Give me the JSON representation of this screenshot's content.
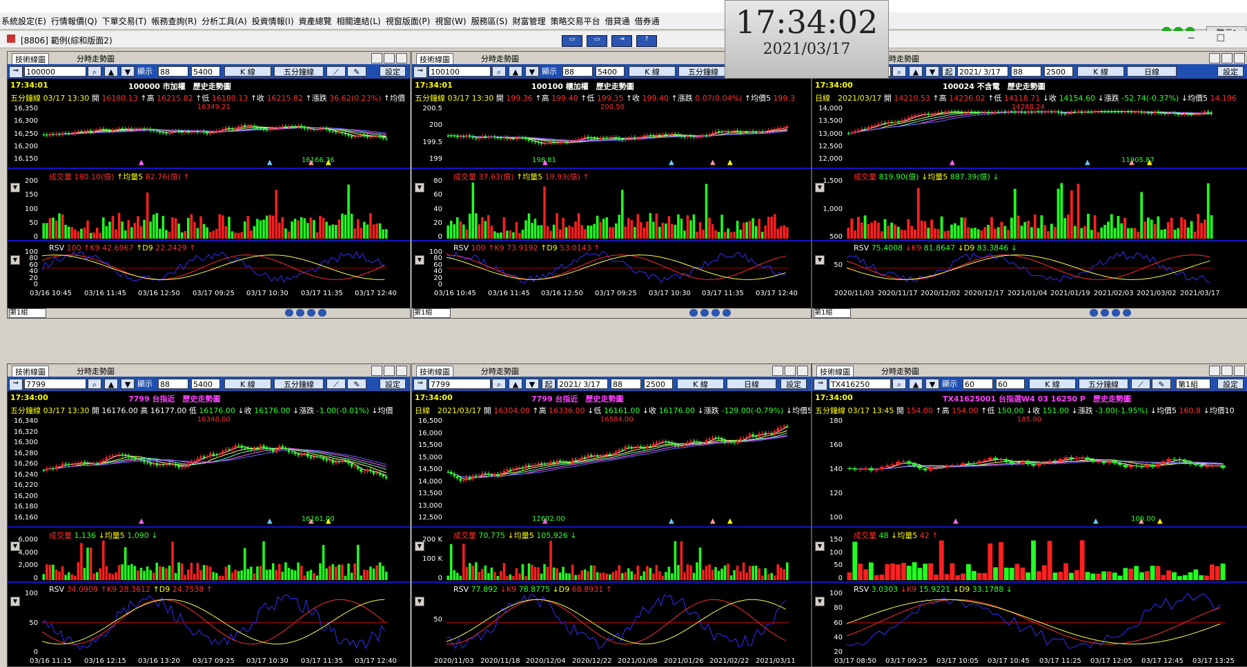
{
  "menu": [
    "系統設定(E)",
    "行情報價(Q)",
    "下單交易(T)",
    "帳務查詢(R)",
    "分析工具(A)",
    "投資情報(I)",
    "資產總覽",
    "相關連結(L)",
    "視窗版面(P)",
    "視窗(W)",
    "服務區(S)",
    "財富管理",
    "策略交易平台",
    "借貸通",
    "借券通"
  ],
  "clock": {
    "time": "17:34:02",
    "date": "2021/03/17"
  },
  "alarm_label": "警示!",
  "doc_title": "[8806] 範例(綜和版面2)",
  "tabs": {
    "tech": "技術線圖",
    "intraday": "分時走勢圖"
  },
  "settings_label": "設定",
  "display_label": "顯示",
  "kline_label": "K 線",
  "five_min_label": "五分鐘線",
  "daily_label": "日線",
  "group_label": "第1組",
  "panels": [
    {
      "code": "100000",
      "n": "88",
      "count": "5400",
      "period": "五分鐘線",
      "time": "17:34:01",
      "title": "100000 市加權　歷史走勢圖",
      "quote": [
        [
          "五分鐘線 03/17 13:30",
          "y"
        ],
        [
          " 開 ",
          "w"
        ],
        [
          "16180.13",
          "r"
        ],
        [
          " ↑高 ",
          "w"
        ],
        [
          "16215.82",
          "r"
        ],
        [
          " ↑低 ",
          "w"
        ],
        [
          "16180.13",
          "r"
        ],
        [
          " ↑收 ",
          "w"
        ],
        [
          "16215.82",
          "r"
        ],
        [
          " ↑漲跌 ",
          "w"
        ],
        [
          "36.62(0.23%)",
          "r"
        ],
        [
          " ↑均價",
          "w"
        ]
      ],
      "vol": [
        [
          "成交量 ",
          "r"
        ],
        [
          "180.10(億)",
          "r"
        ],
        [
          " ↑均量5 ",
          "y"
        ],
        [
          "82.76(億)",
          "r"
        ],
        [
          " ↑",
          "r"
        ]
      ],
      "kd": [
        [
          "RSV ",
          "w"
        ],
        [
          "100",
          "r"
        ],
        [
          " ↑K9 ",
          "r"
        ],
        [
          "42.6967",
          "r"
        ],
        [
          " ↑D9 ",
          "y"
        ],
        [
          "22.2429",
          "r"
        ],
        [
          " ↑",
          "r"
        ]
      ],
      "yprice": [
        "16,350",
        "16,300",
        "16,250",
        "16,200",
        "16,150"
      ],
      "yvol": [
        "200",
        "150",
        "100",
        "50",
        "0"
      ],
      "ykd": [
        "100",
        "80",
        "60",
        "40",
        "20",
        "0"
      ],
      "x": [
        "03/16 10:45",
        "03/16 11:45",
        "03/16 12:50",
        "03/17 09:25",
        "03/17 10:30",
        "03/17 11:35",
        "03/17 12:40"
      ],
      "hi": "16349.21",
      "lo": "16166.36"
    },
    {
      "code": "100100",
      "n": "88",
      "count": "5400",
      "period": "五分鐘線",
      "time": "17:34:01",
      "title": "100100 櫃加權　歷史走勢圖",
      "quote": [
        [
          "五分鐘線 03/17 13:30",
          "y"
        ],
        [
          " 開 ",
          "w"
        ],
        [
          "199.36",
          "r"
        ],
        [
          " ↑高 ",
          "w"
        ],
        [
          "199.40",
          "r"
        ],
        [
          " ↑低 ",
          "w"
        ],
        [
          "199.35",
          "r"
        ],
        [
          " ↑收 ",
          "w"
        ],
        [
          "199.40",
          "r"
        ],
        [
          " ↑漲跌 ",
          "w"
        ],
        [
          "0.07(0.04%)",
          "r"
        ],
        [
          " ↑均價5 ",
          "w"
        ],
        [
          "199.3",
          "r"
        ]
      ],
      "vol": [
        [
          "成交量 ",
          "r"
        ],
        [
          "37.63(億)",
          "r"
        ],
        [
          " ↑均量5 ",
          "y"
        ],
        [
          "19.93(億)",
          "r"
        ],
        [
          " ↑",
          "r"
        ]
      ],
      "kd": [
        [
          "RSV ",
          "w"
        ],
        [
          "100",
          "r"
        ],
        [
          " ↑K9 ",
          "r"
        ],
        [
          "73.9192",
          "r"
        ],
        [
          " ↑D9 ",
          "y"
        ],
        [
          "53.0143",
          "r"
        ],
        [
          " ↑",
          "r"
        ]
      ],
      "yprice": [
        "200.5",
        "200",
        "199.5",
        "199"
      ],
      "yvol": [
        "80",
        "60",
        "40",
        "20",
        "0"
      ],
      "ykd": [
        "100",
        "80",
        "60",
        "40",
        "20",
        "0"
      ],
      "x": [
        "03/16 10:45",
        "03/16 11:45",
        "03/16 12:50",
        "03/17 09:25",
        "03/17 10:30",
        "03/17 11:35",
        "03/17 12:40"
      ],
      "hi": "200.50",
      "lo": "198.81"
    },
    {
      "code": "100024",
      "n": "88",
      "count": "2500",
      "period": "日線",
      "time": "17:34:00",
      "title": "100024 不含電　歷史走勢圖",
      "start_label": "起",
      "date": "2021/ 3/17",
      "quote": [
        [
          "日線　2021/03/17",
          "y"
        ],
        [
          " 開 ",
          "w"
        ],
        [
          "14210.53",
          "r"
        ],
        [
          " ↑高 ",
          "w"
        ],
        [
          "14236.02",
          "r"
        ],
        [
          " ↑低 ",
          "w"
        ],
        [
          "14118.71",
          "r"
        ],
        [
          " ↓收 ",
          "w"
        ],
        [
          "14154.60",
          "g"
        ],
        [
          " ↓漲跌 ",
          "w"
        ],
        [
          "-52.74(-0.37%)",
          "g"
        ],
        [
          " ↓均價5 ",
          "w"
        ],
        [
          "14,196",
          "r"
        ]
      ],
      "vol": [
        [
          "成交量 ",
          "r"
        ],
        [
          "819.90(億)",
          "g"
        ],
        [
          " ↓均量5 ",
          "y"
        ],
        [
          "887.39(億)",
          "g"
        ],
        [
          " ↓",
          "g"
        ]
      ],
      "kd": [
        [
          "RSV ",
          "w"
        ],
        [
          "75.4008",
          "g"
        ],
        [
          " ↓K9 ",
          "r"
        ],
        [
          "81.8647",
          "g"
        ],
        [
          " ↓D9 ",
          "y"
        ],
        [
          "83.3846",
          "g"
        ],
        [
          " ↓",
          "g"
        ]
      ],
      "yprice": [
        "14,000",
        "13,500",
        "13,000",
        "12,500",
        "12,000"
      ],
      "yvol": [
        "1,500",
        "1,000",
        "500"
      ],
      "ykd": [
        "50"
      ],
      "x": [
        "2020/11/03",
        "2020/11/17",
        "2020/12/02",
        "2020/12/17",
        "2021/01/04",
        "2021/01/19",
        "2021/02/03",
        "2021/03/02",
        "2021/03/17"
      ],
      "hi": "14288.24",
      "lo": "11905.87"
    },
    {
      "code": "7799",
      "n": "88",
      "count": "5400",
      "period": "五分鐘線",
      "time": "17:34:00",
      "title": "7799 台指近　歷史走勢圖",
      "quote": [
        [
          "五分鐘線 03/17 13:30",
          "y"
        ],
        [
          " 開 ",
          "w"
        ],
        [
          "16176.00",
          "w"
        ],
        [
          " 高 ",
          "w"
        ],
        [
          "16177.00",
          "w"
        ],
        [
          " 低 ",
          "w"
        ],
        [
          "16176.00",
          "g"
        ],
        [
          " ↓收 ",
          "w"
        ],
        [
          "16176.00",
          "g"
        ],
        [
          " ↓漲跌 ",
          "w"
        ],
        [
          "-1.00(-0.01%)",
          "g"
        ],
        [
          " ↓均價",
          "w"
        ]
      ],
      "vol": [
        [
          "成交量 ",
          "r"
        ],
        [
          "1,136",
          "g"
        ],
        [
          " ↓均量5 ",
          "y"
        ],
        [
          "1,090",
          "g"
        ],
        [
          " ↓",
          "g"
        ]
      ],
      "kd": [
        [
          "RSV ",
          "w"
        ],
        [
          "34.0909",
          "r"
        ],
        [
          " ↑K9 ",
          "r"
        ],
        [
          "28.3612",
          "r"
        ],
        [
          " ↑D9 ",
          "y"
        ],
        [
          "24.7538",
          "r"
        ],
        [
          " ↑",
          "r"
        ]
      ],
      "yprice": [
        "16,340",
        "16,320",
        "16,300",
        "16,280",
        "16,260",
        "16,240",
        "16,220",
        "16,200",
        "16,180",
        "16,160"
      ],
      "yvol": [
        "6,000",
        "4,000",
        "2,000",
        "0"
      ],
      "ykd": [
        "100",
        "50",
        "0"
      ],
      "x": [
        "03/16 11:15",
        "03/16 12:15",
        "03/16 13:20",
        "03/17 09:25",
        "03/17 10:30",
        "03/17 11:35",
        "03/17 12:40"
      ],
      "hi": "16348.00",
      "lo": "16161.00"
    },
    {
      "code": "7799",
      "n": "88",
      "count": "2500",
      "period": "日線",
      "time": "17:34:00",
      "title": "7799 台指近　歷史走勢圖",
      "start_label": "起",
      "date": "2021/ 3/17",
      "quote": [
        [
          "日線　2021/03/17",
          "y"
        ],
        [
          " 開 ",
          "w"
        ],
        [
          "16304.00",
          "r"
        ],
        [
          " ↑高 ",
          "w"
        ],
        [
          "16336.00",
          "r"
        ],
        [
          " ↓低 ",
          "w"
        ],
        [
          "16161.00",
          "g"
        ],
        [
          " ↓收 ",
          "w"
        ],
        [
          "16176.00",
          "g"
        ],
        [
          " ↓漲跌 ",
          "w"
        ],
        [
          "-129.00(-0.79%)",
          "g"
        ],
        [
          " ↓均價5",
          "w"
        ]
      ],
      "vol": [
        [
          "成交量 ",
          "r"
        ],
        [
          "70,775",
          "g"
        ],
        [
          " ↓均量5 ",
          "y"
        ],
        [
          "105,926",
          "g"
        ],
        [
          " ↓",
          "g"
        ]
      ],
      "kd": [
        [
          "RSV ",
          "w"
        ],
        [
          "77.892",
          "g"
        ],
        [
          " ↓K9 ",
          "r"
        ],
        [
          "78.8775",
          "g"
        ],
        [
          " ↓D9 ",
          "y"
        ],
        [
          "68.8931",
          "r"
        ],
        [
          " ↑",
          "r"
        ]
      ],
      "yprice": [
        "16,500",
        "16,000",
        "15,500",
        "15,000",
        "14,500",
        "14,000",
        "13,500",
        "13,000",
        "12,500"
      ],
      "yvol": [
        "200 K",
        "100 K",
        "0"
      ],
      "ykd": [
        "50"
      ],
      "x": [
        "2020/11/03",
        "2020/11/18",
        "2020/12/04",
        "2020/12/22",
        "2021/01/08",
        "2021/01/26",
        "2021/02/22",
        "2021/03/11"
      ],
      "hi": "16584.00",
      "lo": "12602.00"
    },
    {
      "code": "TX416250",
      "n": "60",
      "count": "60",
      "period": "五分鐘線",
      "time": "17:34:00",
      "title": "TX41625001 台指選W4 03 16250 P　歷史走勢圖",
      "group": "第1組",
      "quote": [
        [
          "五分鐘線 03/17 13:45",
          "y"
        ],
        [
          " 開 ",
          "w"
        ],
        [
          "154.00",
          "r"
        ],
        [
          " ↑高 ",
          "w"
        ],
        [
          "154.00",
          "r"
        ],
        [
          " ↑低 ",
          "w"
        ],
        [
          "150.00",
          "g"
        ],
        [
          " ↓收 ",
          "w"
        ],
        [
          "151.00",
          "g"
        ],
        [
          " ↓漲跌 ",
          "w"
        ],
        [
          "-3.00(-1.95%)",
          "g"
        ],
        [
          " ↓均價5 ",
          "w"
        ],
        [
          "160.8",
          "r"
        ],
        [
          " ↓均價10",
          "w"
        ]
      ],
      "vol": [
        [
          "成交量 ",
          "r"
        ],
        [
          "48",
          "g"
        ],
        [
          " ↓均量5 ",
          "y"
        ],
        [
          "42",
          "r"
        ],
        [
          " ↑",
          "r"
        ]
      ],
      "kd": [
        [
          "RSV ",
          "w"
        ],
        [
          "3.0303",
          "g"
        ],
        [
          " ↓K9 ",
          "r"
        ],
        [
          "15.9221",
          "g"
        ],
        [
          " ↓D9 ",
          "y"
        ],
        [
          "33.1788",
          "g"
        ],
        [
          " ↓",
          "g"
        ]
      ],
      "yprice": [
        "180",
        "160",
        "140",
        "120",
        "100"
      ],
      "yvol": [
        "150",
        "100",
        "50",
        "0"
      ],
      "ykd": [
        "100",
        "80",
        "60",
        "40",
        "20"
      ],
      "x": [
        "03/17 08:50",
        "03/17 09:25",
        "03/17 10:05",
        "03/17 10:45",
        "03/17 11:25",
        "03/17 12:05",
        "03/17 12:45",
        "03/17 13:25"
      ],
      "hi": "185.00",
      "lo": "106.00"
    }
  ]
}
